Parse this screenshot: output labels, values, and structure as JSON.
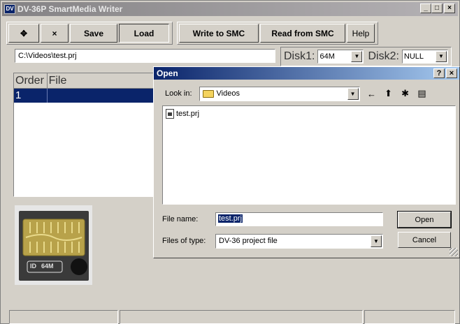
{
  "window": {
    "title": "DV-36P SmartMedia Writer",
    "icon_text": "DV",
    "controls": [
      "_",
      "□",
      "×"
    ]
  },
  "toolbar": {
    "add_label": "✥",
    "remove_label": "×",
    "save_label": "Save",
    "load_label": "Load",
    "write_label": "Write to SMC",
    "read_label": "Read from SMC",
    "help_label": "Help"
  },
  "project_path": "C:\\Videos\\test.prj",
  "disks": {
    "disk1_label": "Disk1:",
    "disk1_value": "64M",
    "disk2_label": "Disk2:",
    "disk2_value": "NULL"
  },
  "list": {
    "columns": [
      "Order",
      "File"
    ],
    "rows": [
      {
        "order": "1",
        "file": ""
      }
    ]
  },
  "card": {
    "capacity": "64M",
    "id_label": "ID"
  },
  "dialog": {
    "title": "Open",
    "help_btn": "?",
    "close_btn": "×",
    "look_in_label": "Look in:",
    "look_in_value": "Videos",
    "files": [
      "test.prj"
    ],
    "file_name_label": "File name:",
    "file_name_value": "test.prj",
    "file_type_label": "Files of type:",
    "file_type_value": "DV-36 project file",
    "open_label": "Open",
    "cancel_label": "Cancel"
  }
}
